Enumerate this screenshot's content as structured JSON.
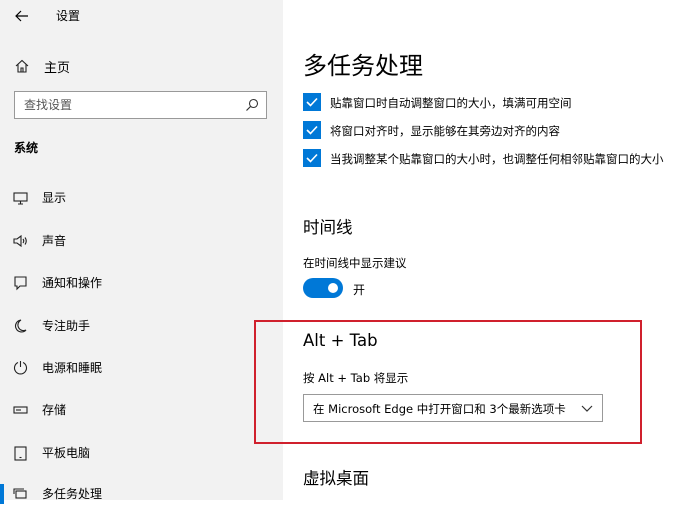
{
  "window": {
    "title": "设置",
    "back_label": "←"
  },
  "sidebar": {
    "home_label": "主页",
    "search_placeholder": "查找设置",
    "section_label": "系统",
    "items": [
      {
        "label": "显示",
        "icon": "monitor-icon"
      },
      {
        "label": "声音",
        "icon": "speaker-icon"
      },
      {
        "label": "通知和操作",
        "icon": "notification-icon"
      },
      {
        "label": "专注助手",
        "icon": "moon-icon"
      },
      {
        "label": "电源和睡眠",
        "icon": "power-icon"
      },
      {
        "label": "存储",
        "icon": "storage-icon"
      },
      {
        "label": "平板电脑",
        "icon": "tablet-icon"
      },
      {
        "label": "多任务处理",
        "icon": "multitask-icon",
        "active": true
      }
    ]
  },
  "main": {
    "page_title": "多任务处理",
    "snap_options": [
      {
        "label": "贴靠窗口时自动调整窗口的大小，填满可用空间",
        "checked": true
      },
      {
        "label": "将窗口对齐时，显示能够在其旁边对齐的内容",
        "checked": true
      },
      {
        "label": "当我调整某个贴靠窗口的大小时，也调整任何相邻贴靠窗口的大小",
        "checked": true
      }
    ],
    "timeline": {
      "heading": "时间线",
      "suggestion_label": "在时间线中显示建议",
      "toggle_state": "开"
    },
    "alt_tab": {
      "heading": "Alt + Tab",
      "label": "按 Alt + Tab 将显示",
      "selected_option": "在 Microsoft Edge 中打开窗口和 3个最新选项卡"
    },
    "virtual_desktops": {
      "heading": "虚拟桌面"
    }
  },
  "colors": {
    "accent": "#0078d7",
    "highlight_box": "#d0202d",
    "sidebar_bg": "#f2f2f2"
  }
}
